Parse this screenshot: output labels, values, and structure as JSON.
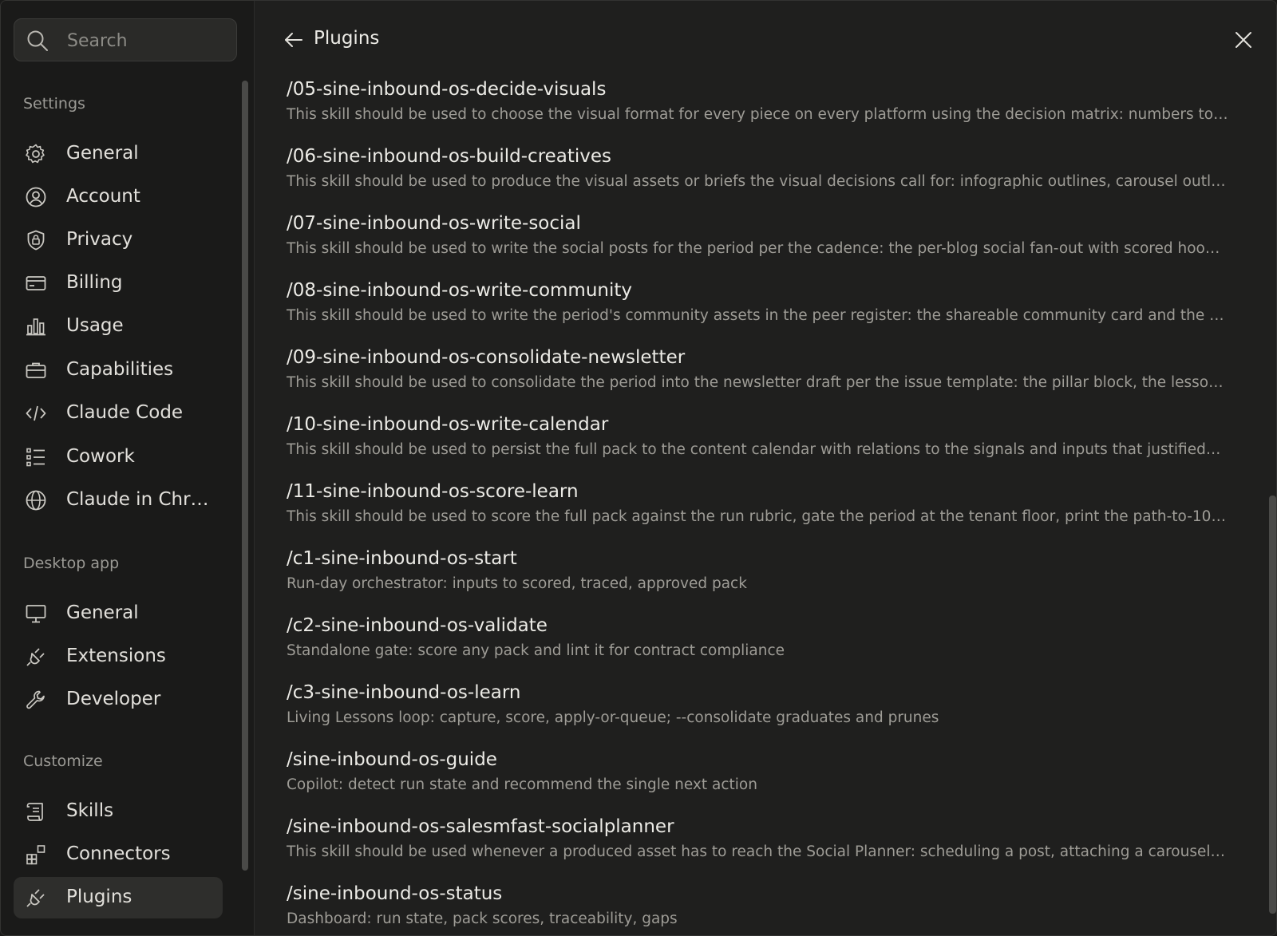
{
  "sidebar": {
    "search": {
      "placeholder": "Search",
      "value": ""
    },
    "sections": [
      {
        "label": "Settings",
        "items": [
          {
            "label": "General",
            "icon": "gear-icon"
          },
          {
            "label": "Account",
            "icon": "user-circle-icon"
          },
          {
            "label": "Privacy",
            "icon": "shield-lock-icon"
          },
          {
            "label": "Billing",
            "icon": "card-icon"
          },
          {
            "label": "Usage",
            "icon": "bar-chart-icon"
          },
          {
            "label": "Capabilities",
            "icon": "briefcase-icon"
          },
          {
            "label": "Claude Code",
            "icon": "code-icon"
          },
          {
            "label": "Cowork",
            "icon": "list-icon"
          },
          {
            "label": "Claude in Chr…",
            "icon": "globe-icon"
          }
        ]
      },
      {
        "label": "Desktop app",
        "items": [
          {
            "label": "General",
            "icon": "monitor-icon"
          },
          {
            "label": "Extensions",
            "icon": "plug-icon"
          },
          {
            "label": "Developer",
            "icon": "wrench-icon"
          }
        ]
      },
      {
        "label": "Customize",
        "items": [
          {
            "label": "Skills",
            "icon": "scroll-icon"
          },
          {
            "label": "Connectors",
            "icon": "blocks-icon"
          },
          {
            "label": "Plugins",
            "icon": "plug-icon",
            "active": true
          }
        ]
      }
    ]
  },
  "header": {
    "title": "Plugins"
  },
  "plugins": [
    {
      "name": "/05-sine-inbound-os-decide-visuals",
      "description": "This skill should be used to choose the visual format for every piece on every platform using the decision matrix: numbers to…"
    },
    {
      "name": "/06-sine-inbound-os-build-creatives",
      "description": "This skill should be used to produce the visual assets or briefs the visual decisions call for: infographic outlines, carousel outl…"
    },
    {
      "name": "/07-sine-inbound-os-write-social",
      "description": "This skill should be used to write the social posts for the period per the cadence: the per-blog social fan-out with scored hoo…"
    },
    {
      "name": "/08-sine-inbound-os-write-community",
      "description": "This skill should be used to write the period's community assets in the peer register: the shareable community card and the …"
    },
    {
      "name": "/09-sine-inbound-os-consolidate-newsletter",
      "description": "This skill should be used to consolidate the period into the newsletter draft per the issue template: the pillar block, the lesso…"
    },
    {
      "name": "/10-sine-inbound-os-write-calendar",
      "description": "This skill should be used to persist the full pack to the content calendar with relations to the signals and inputs that justified…"
    },
    {
      "name": "/11-sine-inbound-os-score-learn",
      "description": "This skill should be used to score the full pack against the run rubric, gate the period at the tenant floor, print the path-to-10, …"
    },
    {
      "name": "/c1-sine-inbound-os-start",
      "description": "Run-day orchestrator: inputs to scored, traced, approved pack"
    },
    {
      "name": "/c2-sine-inbound-os-validate",
      "description": "Standalone gate: score any pack and lint it for contract compliance"
    },
    {
      "name": "/c3-sine-inbound-os-learn",
      "description": "Living Lessons loop: capture, score, apply-or-queue; --consolidate graduates and prunes"
    },
    {
      "name": "/sine-inbound-os-guide",
      "description": "Copilot: detect run state and recommend the single next action"
    },
    {
      "name": "/sine-inbound-os-salesmfast-socialplanner",
      "description": "This skill should be used whenever a produced asset has to reach the Social Planner: scheduling a post, attaching a carousel,…"
    },
    {
      "name": "/sine-inbound-os-status",
      "description": "Dashboard: run state, pack scores, traceability, gaps"
    }
  ]
}
